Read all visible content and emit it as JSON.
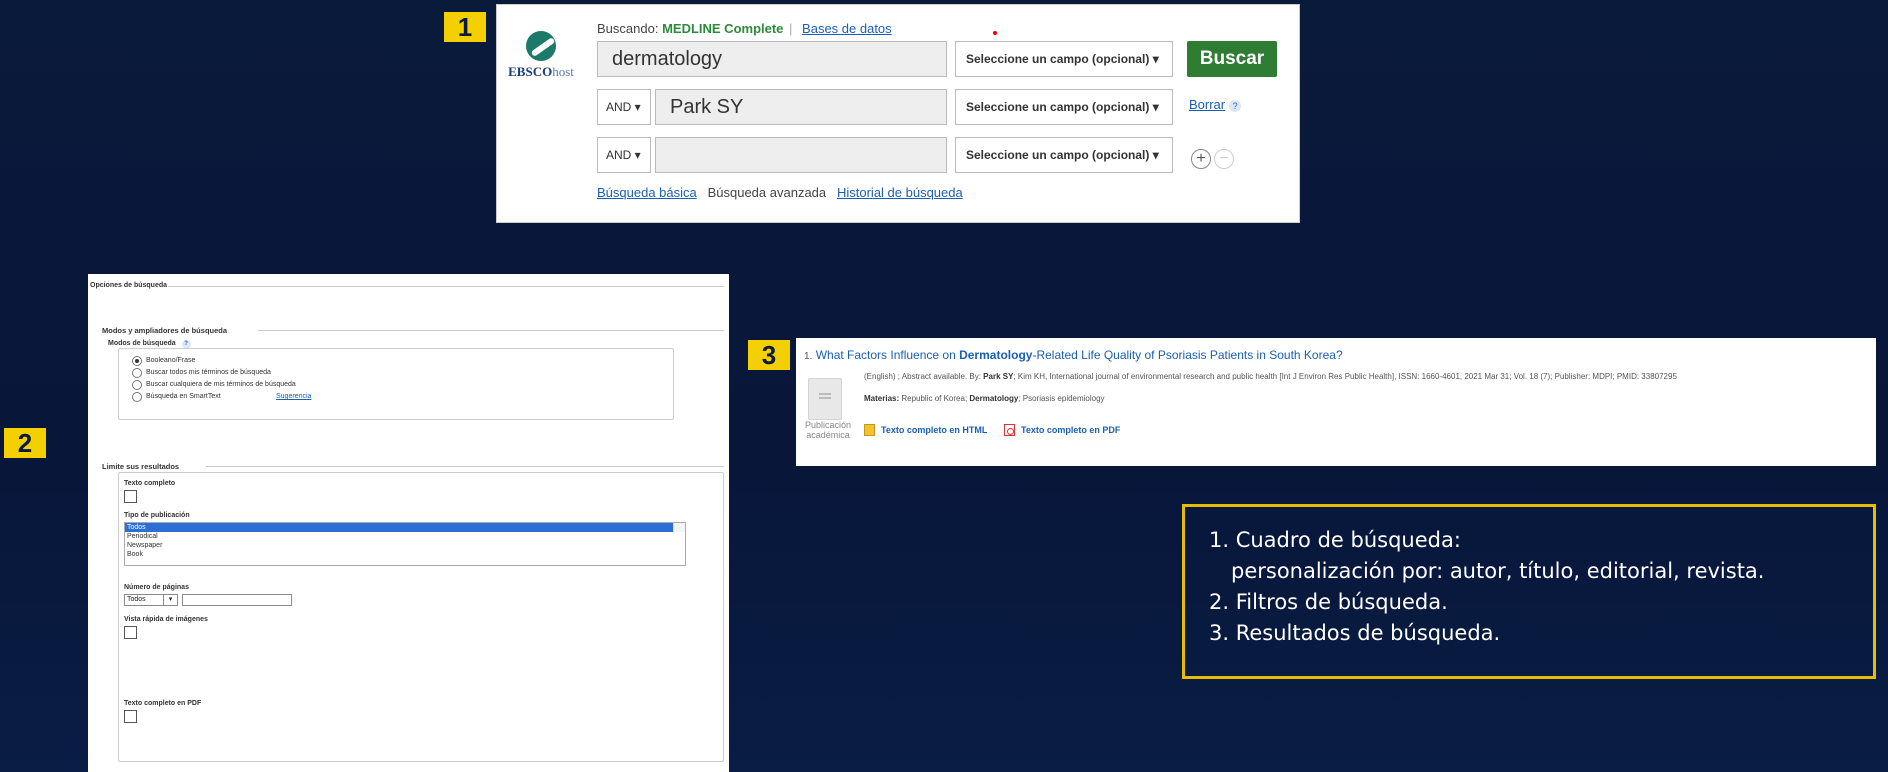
{
  "markers": {
    "one": "1",
    "two": "2",
    "three": "3"
  },
  "search_box": {
    "logo_text": "EBSCO",
    "logo_suffix": "host",
    "searching_label": "Buscando:",
    "database": "MEDLINE Complete",
    "separator": "|",
    "databases_link": "Bases de datos",
    "rows": [
      {
        "operator": "",
        "term": "dermatology",
        "field": "Seleccione un campo (opcional) ▾"
      },
      {
        "operator": "AND ▾",
        "term": "Park SY",
        "field": "Seleccione un campo (opcional) ▾"
      },
      {
        "operator": "AND ▾",
        "term": "",
        "field": "Seleccione un campo (opcional) ▾"
      }
    ],
    "search_button": "Buscar",
    "clear_link": "Borrar",
    "help": "?",
    "add": "+",
    "remove": "−",
    "basic_link": "Búsqueda básica",
    "advanced_label": "Búsqueda avanzada",
    "history_link": "Historial de búsqueda"
  },
  "options_panel": {
    "heading": "Opciones de búsqueda",
    "modes_heading": "Modos y ampliadores de búsqueda",
    "modes_label": "Modos de búsqueda",
    "help": "?",
    "modes": [
      {
        "label": "Booleano/Frase",
        "selected": true
      },
      {
        "label": "Buscar todos mis términos de búsqueda",
        "selected": false
      },
      {
        "label": "Buscar cualquiera de mis términos de búsqueda",
        "selected": false
      },
      {
        "label": "Búsqueda en SmartText",
        "selected": false
      }
    ],
    "smarttext_hint": "Sugerencia",
    "limit_heading": "Limite sus resultados",
    "full_text_label": "Texto completo",
    "pub_type_label": "Tipo de publicación",
    "pub_types": [
      "Todos",
      "Periodical",
      "Newspaper",
      "Book"
    ],
    "pages_label": "Número de páginas",
    "pages_select": "Todos",
    "dropdown": "▾",
    "image_quickview_label": "Vista rápida de imágenes",
    "pdf_full_text_label": "Texto completo en PDF"
  },
  "result": {
    "number": "1.",
    "title_pre": "What Factors Influence on ",
    "title_hl": "Dermatology",
    "title_post": "-Related Life Quality of Psoriasis Patients in South Korea?",
    "meta_pre": "(English) ; Abstract available. By: ",
    "meta_author": "Park SY",
    "meta_post": "; Kim KH, International journal of environmental research and public health [Int J Environ Res Public Health], ISSN: 1660-4601, 2021 Mar 31; Vol. 18 (7); Publisher: MDPI; PMID: 33807295",
    "subjects_label": "Materias:",
    "subjects_pre": " Republic of Korea; ",
    "subjects_hl": "Dermatology",
    "subjects_post": "; Psoriasis epidemiology",
    "type_line1": "Publicación",
    "type_line2": "académica",
    "html_link": "Texto completo en HTML",
    "pdf_link": "Texto completo en PDF"
  },
  "legend": {
    "line1": "1. Cuadro de búsqueda:",
    "line1b": "personalización por: autor, título, editorial, revista.",
    "line2": "2. Filtros de búsqueda.",
    "line3": "3. Resultados de búsqueda."
  },
  "colors": {
    "marker": "#f5d000",
    "search_button": "#2e7d32",
    "link": "#1a5fb4",
    "selection": "#2b6fd6"
  }
}
